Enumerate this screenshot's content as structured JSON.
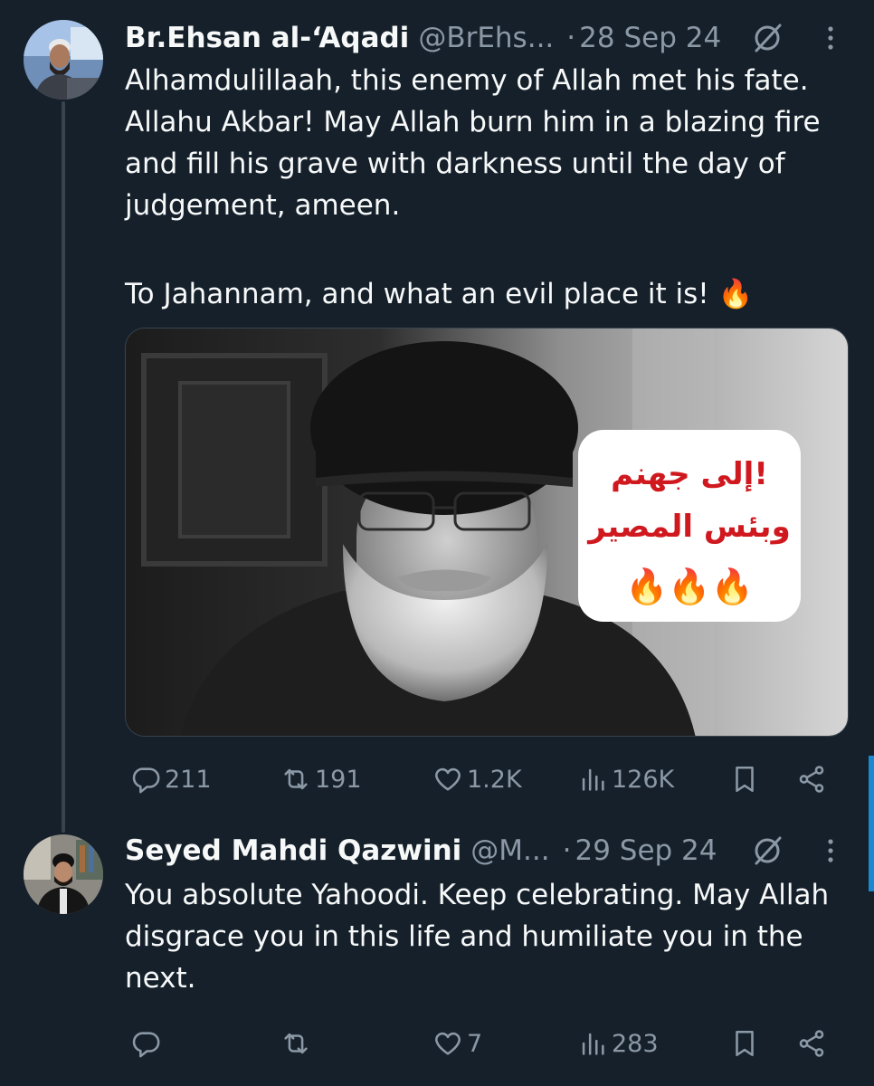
{
  "tweets": [
    {
      "name": "Br.Ehsan al-‘Aqadi",
      "handle": "@BrEhs...",
      "dot": "·",
      "date": "28 Sep 24",
      "paragraphs": [
        "Alhamdulillaah, this enemy of Allah met his fate. Allahu Akbar! May Allah burn him in a blazing fire and fill his grave with darkness until the day of judgement, ameen.",
        "To Jahannam, and what an evil place it is! 🔥"
      ],
      "media": {
        "overlay_line1": "إلى جهنم!",
        "overlay_line2": "وبئس المصير",
        "overlay_flames": "🔥🔥🔥"
      },
      "actions": {
        "replies": "211",
        "retweets": "191",
        "likes": "1.2K",
        "views": "126K"
      }
    },
    {
      "name": "Seyed Mahdi Qazwini",
      "handle": "@M...",
      "dot": "·",
      "date": "29 Sep 24",
      "paragraphs": [
        "You absolute Yahoodi. Keep celebrating. May Allah disgrace you in this life and humiliate you in the next."
      ],
      "actions": {
        "replies": "",
        "retweets": "",
        "likes": "7",
        "views": "283"
      }
    }
  ],
  "colors": {
    "background": "#15202b",
    "text_primary": "#f7f9f9",
    "text_secondary": "#8b98a5",
    "thread_line": "#38444d",
    "accent": "#1d9bf0",
    "overlay_text_red": "#d0191f"
  },
  "icons": [
    "reply-icon",
    "retweet-icon",
    "like-icon",
    "views-icon",
    "bookmark-icon",
    "share-icon",
    "grok-icon",
    "more-icon"
  ]
}
